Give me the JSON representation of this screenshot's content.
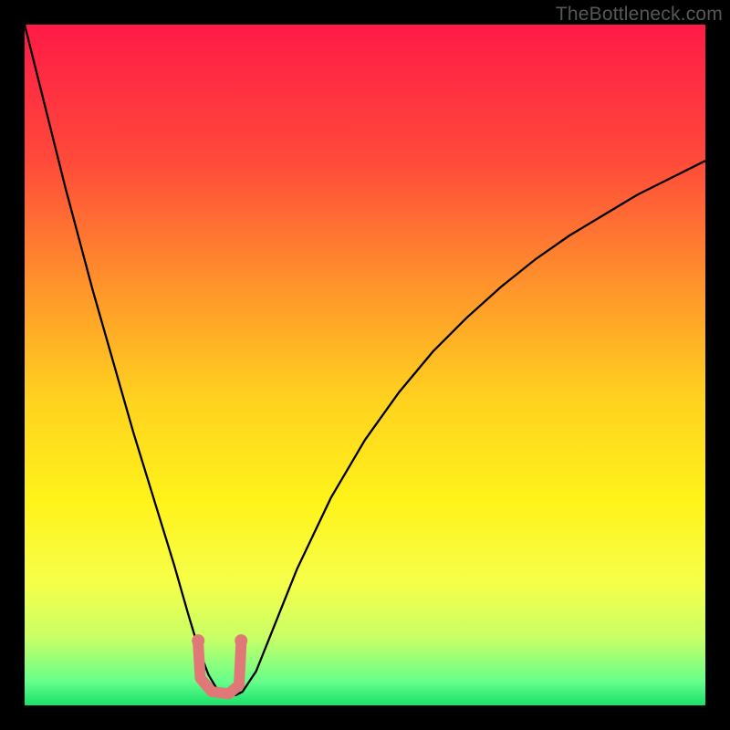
{
  "watermark": "TheBottleneck.com",
  "chart_data": {
    "type": "line",
    "title": "",
    "xlabel": "",
    "ylabel": "",
    "xlim": [
      0,
      100
    ],
    "ylim": [
      0,
      100
    ],
    "grid": false,
    "legend": false,
    "background_gradient_stops": [
      {
        "offset": 0.0,
        "color": "#ff1a47"
      },
      {
        "offset": 0.2,
        "color": "#ff4a3a"
      },
      {
        "offset": 0.4,
        "color": "#ff9a2a"
      },
      {
        "offset": 0.55,
        "color": "#ffd21f"
      },
      {
        "offset": 0.7,
        "color": "#fff31a"
      },
      {
        "offset": 0.82,
        "color": "#f6ff4a"
      },
      {
        "offset": 0.9,
        "color": "#c9ff66"
      },
      {
        "offset": 0.965,
        "color": "#66ff8a"
      },
      {
        "offset": 1.0,
        "color": "#18e06a"
      }
    ],
    "series": [
      {
        "name": "bottleneck-curve",
        "color": "#000000",
        "width": 2.3,
        "x": [
          0.0,
          2.0,
          4.0,
          6.0,
          8.0,
          10.0,
          12.0,
          14.0,
          16.0,
          18.0,
          20.0,
          22.0,
          24.0,
          25.5,
          27.0,
          28.5,
          30.0,
          31.0,
          32.0,
          34.0,
          36.0,
          40.0,
          45.0,
          50.0,
          55.0,
          60.0,
          65.0,
          70.0,
          75.0,
          80.0,
          85.0,
          90.0,
          95.0,
          100.0
        ],
        "y": [
          100.0,
          92.0,
          84.0,
          76.0,
          68.5,
          61.0,
          54.0,
          47.0,
          40.0,
          33.5,
          27.0,
          20.5,
          13.5,
          8.5,
          4.5,
          2.0,
          1.5,
          1.5,
          2.0,
          5.0,
          10.0,
          20.0,
          30.5,
          39.0,
          46.0,
          52.0,
          57.0,
          61.5,
          65.5,
          69.0,
          72.0,
          75.0,
          77.5,
          80.0
        ]
      }
    ],
    "marker_overlay": {
      "name": "sweet-spot-marker",
      "color": "#e17878",
      "stroke_width": 12,
      "points": [
        {
          "x": 25.5,
          "y": 9.0
        },
        {
          "x": 25.8,
          "y": 4.0
        },
        {
          "x": 27.5,
          "y": 2.0
        },
        {
          "x": 30.0,
          "y": 1.7
        },
        {
          "x": 31.5,
          "y": 3.0
        },
        {
          "x": 31.8,
          "y": 9.0
        }
      ],
      "end_caps": [
        {
          "x": 25.5,
          "y": 9.5,
          "r": 7
        },
        {
          "x": 31.8,
          "y": 9.5,
          "r": 7
        }
      ]
    }
  }
}
